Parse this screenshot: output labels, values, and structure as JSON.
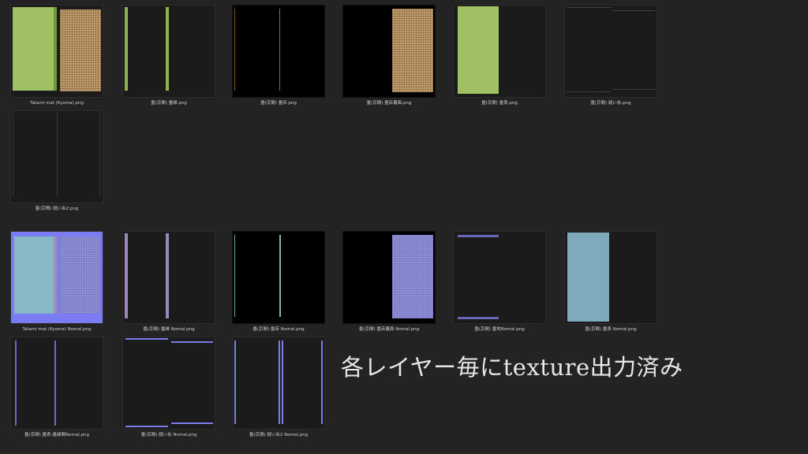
{
  "files": [
    {
      "name": "Tatami mat (Kyoma).png",
      "thumb_icon": "tatami-texture-preview"
    },
    {
      "name": "畳(京間) 畳縁.png",
      "thumb_icon": "tatami-edge-preview"
    },
    {
      "name": "畳(京間) 畳床.png",
      "thumb_icon": "tatami-base-preview"
    },
    {
      "name": "畳(京間) 畳床裏面.png",
      "thumb_icon": "tatami-base-back-preview"
    },
    {
      "name": "畳(京間) 畳表.png",
      "thumb_icon": "tatami-surface-preview"
    },
    {
      "name": "畳(京間) 縫い糸.png",
      "thumb_icon": "stitch-thread-preview"
    },
    {
      "name": "畳(京間) 縫い糸2.png",
      "thumb_icon": "stitch-thread-2-preview"
    },
    {
      "name": "Tatami mat (Kyoma) Nomal.png",
      "thumb_icon": "tatami-normal-preview"
    },
    {
      "name": "畳(京間) 畳縁 Nomal.png",
      "thumb_icon": "tatami-edge-normal-preview"
    },
    {
      "name": "畳(京間) 畳床 Nomal.png",
      "thumb_icon": "tatami-base-normal-preview"
    },
    {
      "name": "畳(京間) 畳床裏面 Nomal.png",
      "thumb_icon": "tatami-base-back-normal-preview"
    },
    {
      "name": "畳(京間) 畳地Nomal.png",
      "thumb_icon": "tatami-ground-normal-preview"
    },
    {
      "name": "畳(京間) 畳表 Nomal.png",
      "thumb_icon": "tatami-surface-normal-preview"
    },
    {
      "name": "畳(京間) 畳表-畳縁間Nomal.png",
      "thumb_icon": "tatami-surface-edge-gap-normal-preview"
    },
    {
      "name": "畳(京間) 縫い糸 Nomal.png",
      "thumb_icon": "stitch-thread-normal-preview"
    },
    {
      "name": "畳(京間) 縫い糸2 Nomal.png",
      "thumb_icon": "stitch-thread-2-normal-preview"
    }
  ],
  "overlay_caption": "各レイヤー毎にtexture出力済み",
  "colors": {
    "background": "#232323",
    "green": "#9fc063",
    "tan": "#c4a070",
    "normal_blue": "#8b8bd6",
    "light_blue": "#7fa9bd",
    "caption": "#d0d0d0"
  }
}
